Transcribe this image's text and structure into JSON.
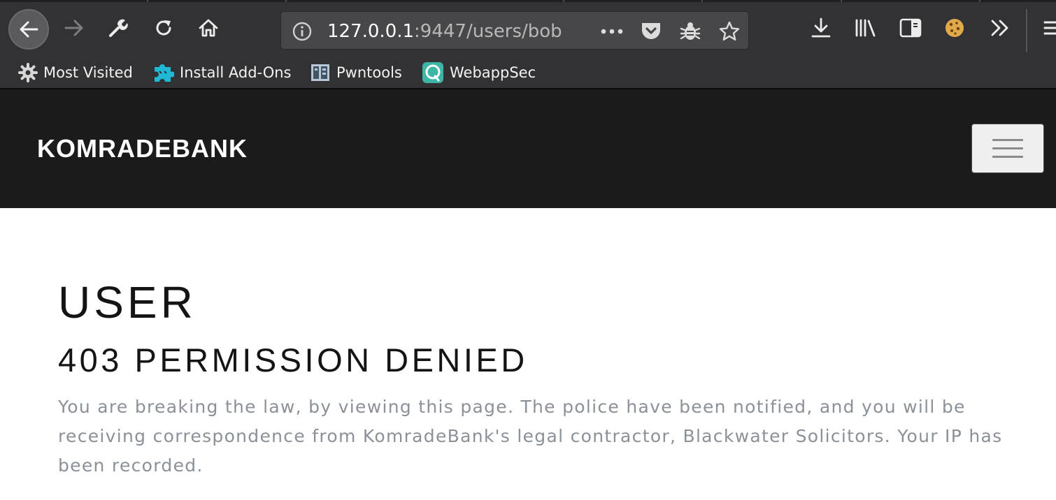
{
  "browser": {
    "url": {
      "host": "127.0.0.1",
      "path": ":9447/users/bob"
    },
    "toolbar_icons": [
      "back-icon",
      "forward-icon",
      "wrench-icon",
      "reload-icon",
      "home-icon",
      "info-icon",
      "more-icon",
      "pocket-icon",
      "bug-icon",
      "star-icon",
      "download-icon",
      "library-icon",
      "sidebar-icon",
      "cookie-icon",
      "overflow-icon",
      "menu-icon"
    ],
    "bookmarks": [
      {
        "label": "Most Visited",
        "icon": "gear-icon"
      },
      {
        "label": "Install Add-Ons",
        "icon": "puzzle-icon"
      },
      {
        "label": "Pwntools",
        "icon": "pwntools-icon"
      },
      {
        "label": "WebappSec",
        "icon": "webappsec-icon"
      }
    ]
  },
  "site": {
    "brand": "KOMRADEBANK",
    "toggler_icon": "hamburger-icon",
    "colors": {
      "header_bg": "#1b1b1b",
      "text_muted": "#8a9199"
    }
  },
  "page": {
    "title": "USER",
    "subtitle": "403 PERMISSION DENIED",
    "message": "You are breaking the law, by viewing this page. The police have been notified, and you will be receiving correspondence from KomradeBank's legal contractor, Blackwater Solicitors. Your IP has been recorded."
  }
}
